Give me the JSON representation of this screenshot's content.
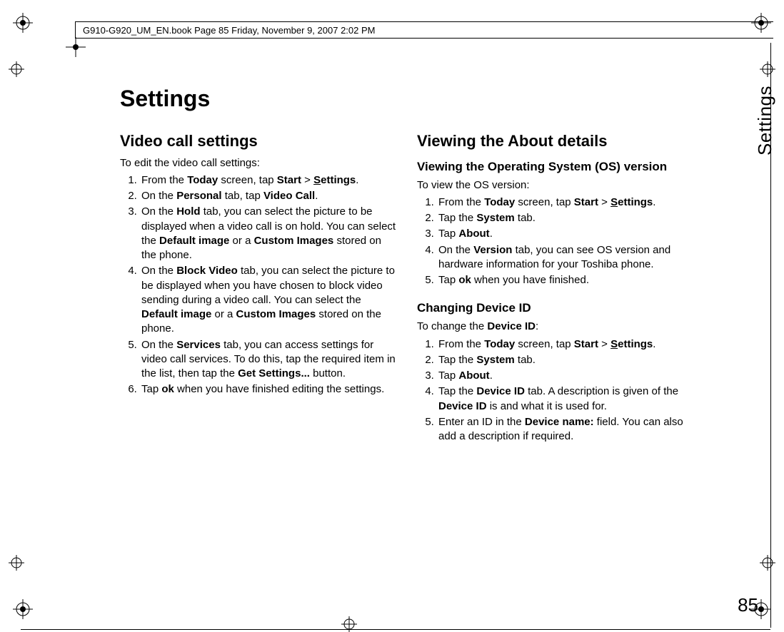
{
  "header": "G910-G920_UM_EN.book  Page 85  Friday, November 9, 2007  2:02 PM",
  "sideLabel": "Settings",
  "pageNumber": "85",
  "title": "Settings",
  "left": {
    "h2": "Video call settings",
    "intro": "To edit the video call settings:",
    "steps": [
      {
        "pre": "From the ",
        "b1": "Today",
        "mid1": " screen, tap ",
        "b2": "Start",
        "mid2": " > ",
        "b3u": "S",
        "b3": "ettings",
        "post": "."
      },
      {
        "pre": "On the ",
        "b1": "Personal",
        "mid1": " tab, tap ",
        "b2": "Video Call",
        "post": "."
      },
      {
        "pre": "On the ",
        "b1": "Hold",
        "mid1": " tab, you can select the picture to be displayed when a video call is on hold. You can select the ",
        "b2": "Default image",
        "mid2": " or a ",
        "b3": "Custom Images",
        "post": " stored on the phone."
      },
      {
        "pre": "On the ",
        "b1": "Block Video",
        "mid1": " tab, you can select the picture to be displayed when you have chosen to block video sending during a video call. You can select the ",
        "b2": "Default image",
        "mid2": " or a ",
        "b3": "Custom Images",
        "post": " stored on the phone."
      },
      {
        "pre": "On the ",
        "b1": "Services",
        "mid1": " tab, you can access settings for video call services. To do this, tap the required item in the list, then tap the ",
        "b2": "Get Settings...",
        "post": " button."
      },
      {
        "pre": "Tap ",
        "b1": "ok",
        "post": " when you have finished editing the settings."
      }
    ]
  },
  "right": {
    "h2": "Viewing the About details",
    "sec1": {
      "h3": "Viewing the Operating System (OS) version",
      "intro": "To view the OS version:",
      "steps": [
        {
          "pre": "From the ",
          "b1": "Today",
          "mid1": " screen, tap ",
          "b2": "Start",
          "mid2": " > ",
          "b3u": "S",
          "b3": "ettings",
          "post": "."
        },
        {
          "pre": "Tap the ",
          "b1": "System",
          "post": " tab."
        },
        {
          "pre": "Tap ",
          "b1": "About",
          "post": "."
        },
        {
          "pre": "On the ",
          "b1": "Version",
          "post": " tab, you can see OS version and hardware information for your Toshiba phone."
        },
        {
          "pre": "Tap ",
          "b1": "ok",
          "post": " when you have finished."
        }
      ]
    },
    "sec2": {
      "h3": "Changing Device ID",
      "introPre": "To change the ",
      "introB": "Device ID",
      "introPost": ":",
      "steps": [
        {
          "pre": "From the ",
          "b1": "Today",
          "mid1": " screen, tap ",
          "b2": "Start",
          "mid2": " > ",
          "b3u": "S",
          "b3": "ettings",
          "post": "."
        },
        {
          "pre": "Tap the ",
          "b1": "System",
          "post": " tab."
        },
        {
          "pre": "Tap ",
          "b1": "About",
          "post": "."
        },
        {
          "pre": "Tap the ",
          "b1": "Device ID",
          "mid1": " tab. A description is given of the ",
          "b2": "Device ID",
          "post": " is and what it is used for."
        },
        {
          "pre": "Enter an ID in the ",
          "b1": "Device name:",
          "post": " field. You can also add a description if required."
        }
      ]
    }
  }
}
